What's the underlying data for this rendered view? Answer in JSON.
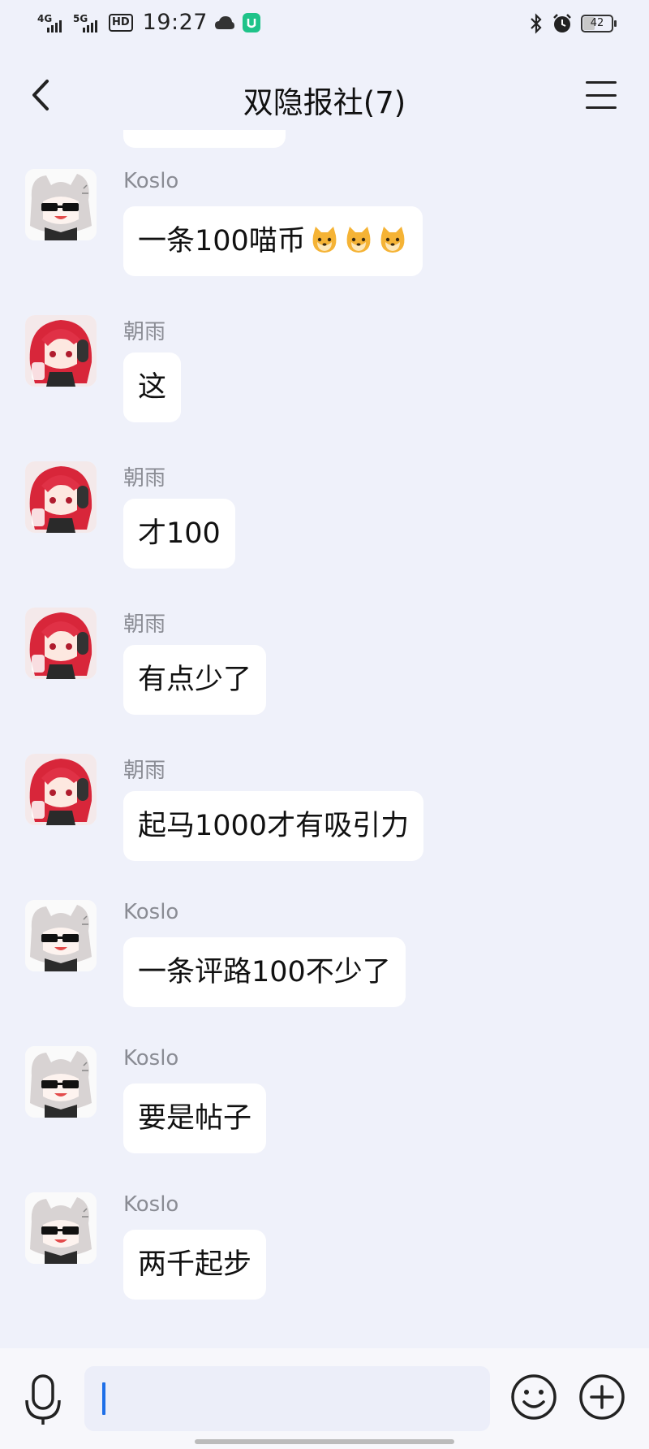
{
  "status_bar": {
    "network_1": "4G",
    "network_2": "5G",
    "hd_label": "HD",
    "time": "19:27",
    "battery": "42",
    "battery_level": 0.42
  },
  "header": {
    "title": "双隐报社(7)"
  },
  "messages": [
    {
      "sender": "Koslo",
      "text": "一条100喵币",
      "emoji_count": 3
    },
    {
      "sender": "朝雨",
      "text": "这"
    },
    {
      "sender": "朝雨",
      "text": "才100"
    },
    {
      "sender": "朝雨",
      "text": "有点少了"
    },
    {
      "sender": "朝雨",
      "text": "起马1000才有吸引力"
    },
    {
      "sender": "Koslo",
      "text": "一条评路100不少了"
    },
    {
      "sender": "Koslo",
      "text": "要是帖子"
    },
    {
      "sender": "Koslo",
      "text": "两千起步"
    }
  ],
  "input": {
    "value": ""
  },
  "colors": {
    "background": "#eff1fa",
    "bubble": "#ffffff",
    "sender": "#8a8c94",
    "caret": "#1e6fe8"
  }
}
